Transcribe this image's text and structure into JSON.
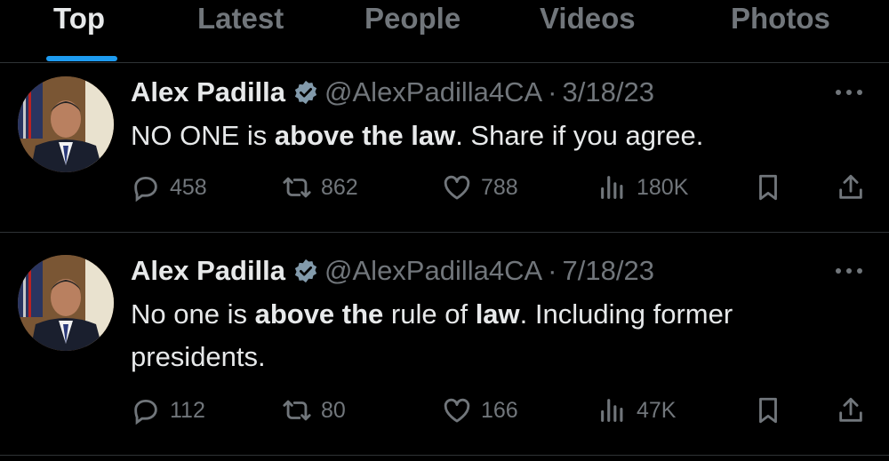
{
  "tabs": [
    {
      "label": "Top",
      "active": true
    },
    {
      "label": "Latest",
      "active": false
    },
    {
      "label": "People",
      "active": false
    },
    {
      "label": "Videos",
      "active": false
    },
    {
      "label": "Photos",
      "active": false
    }
  ],
  "colors": {
    "accent": "#1d9bf0",
    "muted": "#71767b",
    "text": "#e7e9ea",
    "background": "#000000"
  },
  "tweets": [
    {
      "name": "Alex Padilla",
      "handle": "@AlexPadilla4CA",
      "separator": "·",
      "date": "3/18/23",
      "text_parts": [
        {
          "t": "NO ONE is ",
          "b": false
        },
        {
          "t": "above the law",
          "b": true
        },
        {
          "t": ". Share if you agree.",
          "b": false
        }
      ],
      "replies": "458",
      "reposts": "862",
      "likes": "788",
      "views": "180K"
    },
    {
      "name": "Alex Padilla",
      "handle": "@AlexPadilla4CA",
      "separator": "·",
      "date": "7/18/23",
      "text_parts": [
        {
          "t": "No one is ",
          "b": false
        },
        {
          "t": "above the",
          "b": true
        },
        {
          "t": " rule of ",
          "b": false
        },
        {
          "t": "law",
          "b": true
        },
        {
          "t": ". Including former presidents.",
          "b": false
        }
      ],
      "replies": "112",
      "reposts": "80",
      "likes": "166",
      "views": "47K"
    }
  ],
  "icons": [
    "verified-badge-icon",
    "more-icon",
    "reply-icon",
    "repost-icon",
    "like-icon",
    "views-icon",
    "bookmark-icon",
    "share-icon"
  ]
}
